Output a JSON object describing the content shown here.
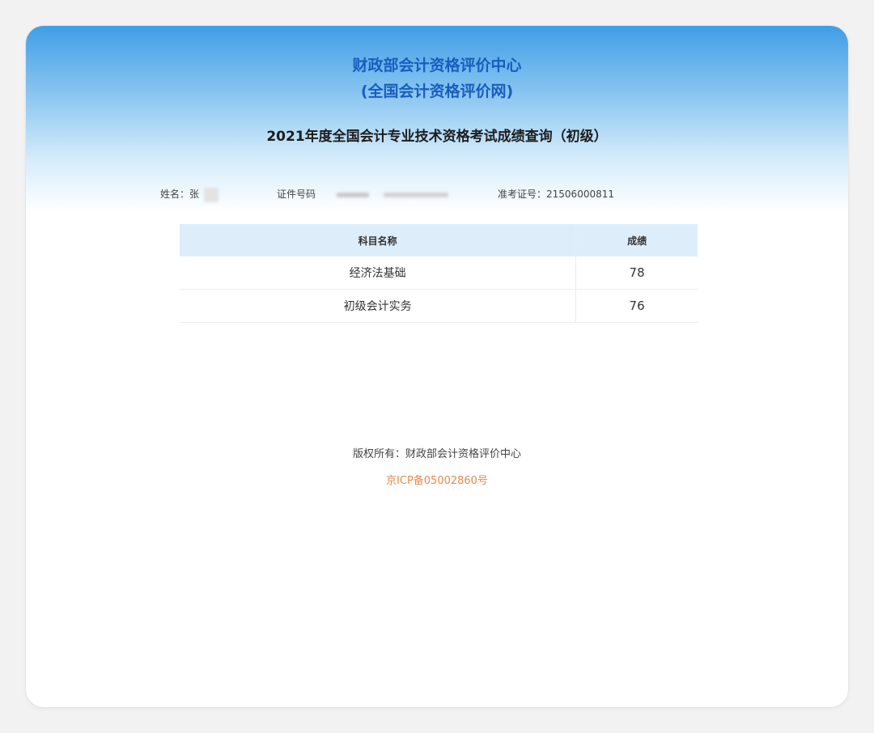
{
  "header": {
    "org_name": "财政部会计资格评价中心",
    "org_subtitle": "(全国会计资格评价网)",
    "page_title": "2021年度全国会计专业技术资格考试成绩查询（初级）"
  },
  "candidate": {
    "name_label": "姓名：",
    "name_value": "张",
    "id_label": "证件号码",
    "exam_no_label": "准考证号：",
    "exam_no_value": "21506000811"
  },
  "table": {
    "headers": [
      "科目名称",
      "成绩"
    ],
    "rows": [
      {
        "subject": "经济法基础",
        "score": "78"
      },
      {
        "subject": "初级会计实务",
        "score": "76"
      }
    ]
  },
  "footer": {
    "copyright": "版权所有：财政部会计资格评价中心",
    "icp": "京ICP备05002860号"
  },
  "colors": {
    "header_blue": "#1a5dbf",
    "table_header_bg": "#ddeefa",
    "icp_orange": "#e8884d"
  }
}
